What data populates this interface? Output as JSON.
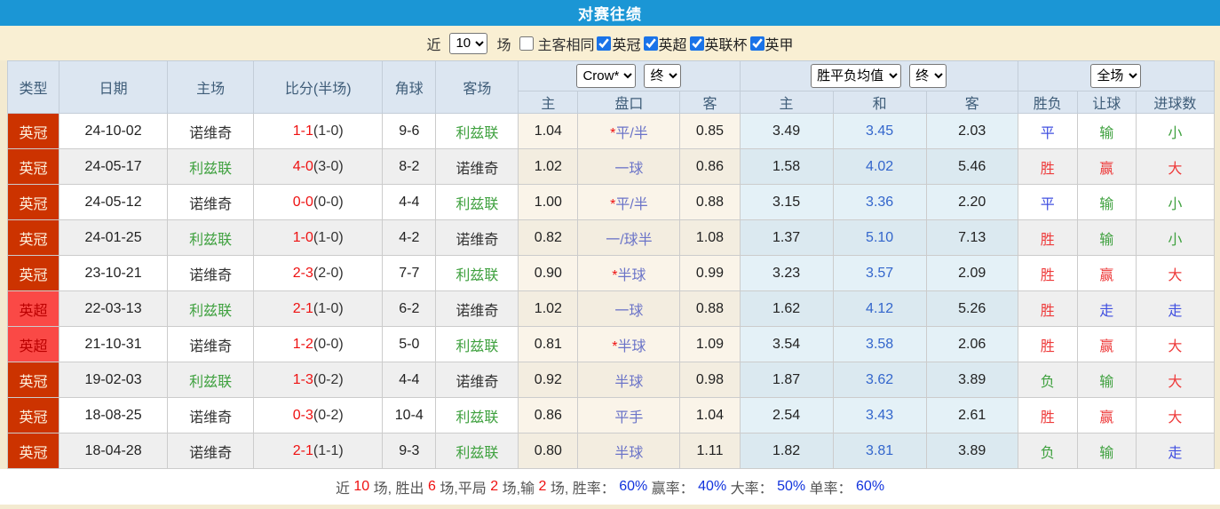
{
  "header": {
    "title": "对赛往绩"
  },
  "filters": {
    "near_label": "近",
    "near_value": "10",
    "games_label": "场",
    "same_venue_label": "主客相同",
    "same_venue_checked": false,
    "leagues": [
      {
        "label": "英冠",
        "checked": true
      },
      {
        "label": "英超",
        "checked": true
      },
      {
        "label": "英联杯",
        "checked": true
      },
      {
        "label": "英甲",
        "checked": true
      }
    ]
  },
  "table": {
    "main_columns": [
      "类型",
      "日期",
      "主场",
      "比分(半场)",
      "角球",
      "客场"
    ],
    "sub_columns": [
      "主",
      "盘口",
      "客",
      "主",
      "和",
      "客",
      "胜负",
      "让球",
      "进球数"
    ],
    "selects": {
      "bookmaker": "Crow*",
      "bookmaker_period": "终",
      "avg": "胜平负均值",
      "avg_period": "终",
      "scope": "全场"
    },
    "rows": [
      {
        "league": "英冠",
        "league_class": "lg-ch",
        "date": "24-10-02",
        "home": "诺维奇",
        "home_class": "team-gray",
        "ft": "1-1",
        "ht": "(1-0)",
        "corners": "9-6",
        "away": "利兹联",
        "away_class": "team-green",
        "crow_home": "1.04",
        "star": "*",
        "handicap": "平/半",
        "crow_away": "0.85",
        "avg_home": "3.49",
        "avg_draw": "3.45",
        "avg_away": "2.03",
        "result": "平",
        "result_class": "res-blue",
        "hcp_res": "输",
        "hcp_res_class": "res-green",
        "goals": "小",
        "goals_class": "res-green"
      },
      {
        "league": "英冠",
        "league_class": "lg-ch",
        "date": "24-05-17",
        "home": "利兹联",
        "home_class": "team-green",
        "ft": "4-0",
        "ht": "(3-0)",
        "corners": "8-2",
        "away": "诺维奇",
        "away_class": "team-gray",
        "crow_home": "1.02",
        "star": "",
        "handicap": "一球",
        "crow_away": "0.86",
        "avg_home": "1.58",
        "avg_draw": "4.02",
        "avg_away": "5.46",
        "result": "胜",
        "result_class": "res-red",
        "hcp_res": "赢",
        "hcp_res_class": "res-red",
        "goals": "大",
        "goals_class": "res-red"
      },
      {
        "league": "英冠",
        "league_class": "lg-ch",
        "date": "24-05-12",
        "home": "诺维奇",
        "home_class": "team-gray",
        "ft": "0-0",
        "ht": "(0-0)",
        "corners": "4-4",
        "away": "利兹联",
        "away_class": "team-green",
        "crow_home": "1.00",
        "star": "*",
        "handicap": "平/半",
        "crow_away": "0.88",
        "avg_home": "3.15",
        "avg_draw": "3.36",
        "avg_away": "2.20",
        "result": "平",
        "result_class": "res-blue",
        "hcp_res": "输",
        "hcp_res_class": "res-green",
        "goals": "小",
        "goals_class": "res-green"
      },
      {
        "league": "英冠",
        "league_class": "lg-ch",
        "date": "24-01-25",
        "home": "利兹联",
        "home_class": "team-green",
        "ft": "1-0",
        "ht": "(1-0)",
        "corners": "4-2",
        "away": "诺维奇",
        "away_class": "team-gray",
        "crow_home": "0.82",
        "star": "",
        "handicap": "一/球半",
        "crow_away": "1.08",
        "avg_home": "1.37",
        "avg_draw": "5.10",
        "avg_away": "7.13",
        "result": "胜",
        "result_class": "res-red",
        "hcp_res": "输",
        "hcp_res_class": "res-green",
        "goals": "小",
        "goals_class": "res-green"
      },
      {
        "league": "英冠",
        "league_class": "lg-ch",
        "date": "23-10-21",
        "home": "诺维奇",
        "home_class": "team-gray",
        "ft": "2-3",
        "ht": "(2-0)",
        "corners": "7-7",
        "away": "利兹联",
        "away_class": "team-green",
        "crow_home": "0.90",
        "star": "*",
        "handicap": "半球",
        "crow_away": "0.99",
        "avg_home": "3.23",
        "avg_draw": "3.57",
        "avg_away": "2.09",
        "result": "胜",
        "result_class": "res-red",
        "hcp_res": "赢",
        "hcp_res_class": "res-red",
        "goals": "大",
        "goals_class": "res-red"
      },
      {
        "league": "英超",
        "league_class": "lg-pr",
        "date": "22-03-13",
        "home": "利兹联",
        "home_class": "team-green",
        "ft": "2-1",
        "ht": "(1-0)",
        "corners": "6-2",
        "away": "诺维奇",
        "away_class": "team-gray",
        "crow_home": "1.02",
        "star": "",
        "handicap": "一球",
        "crow_away": "0.88",
        "avg_home": "1.62",
        "avg_draw": "4.12",
        "avg_away": "5.26",
        "result": "胜",
        "result_class": "res-red",
        "hcp_res": "走",
        "hcp_res_class": "res-blue",
        "goals": "走",
        "goals_class": "res-blue"
      },
      {
        "league": "英超",
        "league_class": "lg-pr",
        "date": "21-10-31",
        "home": "诺维奇",
        "home_class": "team-gray",
        "ft": "1-2",
        "ht": "(0-0)",
        "corners": "5-0",
        "away": "利兹联",
        "away_class": "team-green",
        "crow_home": "0.81",
        "star": "*",
        "handicap": "半球",
        "crow_away": "1.09",
        "avg_home": "3.54",
        "avg_draw": "3.58",
        "avg_away": "2.06",
        "result": "胜",
        "result_class": "res-red",
        "hcp_res": "赢",
        "hcp_res_class": "res-red",
        "goals": "大",
        "goals_class": "res-red"
      },
      {
        "league": "英冠",
        "league_class": "lg-ch",
        "date": "19-02-03",
        "home": "利兹联",
        "home_class": "team-green",
        "ft": "1-3",
        "ht": "(0-2)",
        "corners": "4-4",
        "away": "诺维奇",
        "away_class": "team-gray",
        "crow_home": "0.92",
        "star": "",
        "handicap": "半球",
        "crow_away": "0.98",
        "avg_home": "1.87",
        "avg_draw": "3.62",
        "avg_away": "3.89",
        "result": "负",
        "result_class": "res-green",
        "hcp_res": "输",
        "hcp_res_class": "res-green",
        "goals": "大",
        "goals_class": "res-red"
      },
      {
        "league": "英冠",
        "league_class": "lg-ch",
        "date": "18-08-25",
        "home": "诺维奇",
        "home_class": "team-gray",
        "ft": "0-3",
        "ht": "(0-2)",
        "corners": "10-4",
        "away": "利兹联",
        "away_class": "team-green",
        "crow_home": "0.86",
        "star": "",
        "handicap": "平手",
        "crow_away": "1.04",
        "avg_home": "2.54",
        "avg_draw": "3.43",
        "avg_away": "2.61",
        "result": "胜",
        "result_class": "res-red",
        "hcp_res": "赢",
        "hcp_res_class": "res-red",
        "goals": "大",
        "goals_class": "res-red"
      },
      {
        "league": "英冠",
        "league_class": "lg-ch",
        "date": "18-04-28",
        "home": "诺维奇",
        "home_class": "team-gray",
        "ft": "2-1",
        "ht": "(1-1)",
        "corners": "9-3",
        "away": "利兹联",
        "away_class": "team-green",
        "crow_home": "0.80",
        "star": "",
        "handicap": "半球",
        "crow_away": "1.11",
        "avg_home": "1.82",
        "avg_draw": "3.81",
        "avg_away": "3.89",
        "result": "负",
        "result_class": "res-green",
        "hcp_res": "输",
        "hcp_res_class": "res-green",
        "goals": "走",
        "goals_class": "res-blue"
      }
    ]
  },
  "footer": {
    "segments": [
      {
        "t": "近 ",
        "c": "f-g"
      },
      {
        "t": "10",
        "c": "f-r"
      },
      {
        "t": " 场, 胜出 ",
        "c": "f-g"
      },
      {
        "t": "6",
        "c": "f-r"
      },
      {
        "t": " 场,平局 ",
        "c": "f-g"
      },
      {
        "t": "2",
        "c": "f-r"
      },
      {
        "t": " 场,输 ",
        "c": "f-g"
      },
      {
        "t": "2",
        "c": "f-r"
      },
      {
        "t": " 场, 胜率： ",
        "c": "f-g"
      },
      {
        "t": "60%",
        "c": "f-b"
      },
      {
        "t": " 赢率： ",
        "c": "f-g"
      },
      {
        "t": "40%",
        "c": "f-b"
      },
      {
        "t": " 大率： ",
        "c": "f-g"
      },
      {
        "t": "50%",
        "c": "f-b"
      },
      {
        "t": " 单率： ",
        "c": "f-g"
      },
      {
        "t": "60%",
        "c": "f-b"
      }
    ]
  },
  "colors": {
    "title_bar": "#1b96d5",
    "filter_bar": "#f9efd3",
    "page_bg": "#f3ead0",
    "header_cell": "#dce6f1",
    "league_championship": "#cc3300",
    "league_premier": "#fa4946",
    "draw_odds_text": "#3366cc",
    "handicap_text": "#6b74c8",
    "win_red": "#ee3b3b",
    "lose_green": "#3fa13f",
    "push_blue": "#4150e0"
  }
}
